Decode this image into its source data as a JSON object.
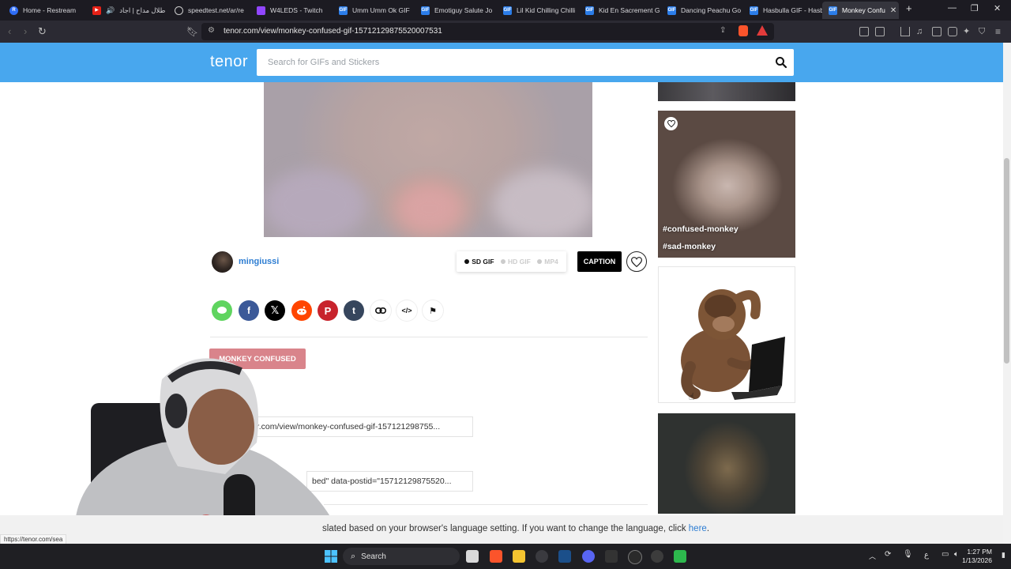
{
  "browser": {
    "tabs": [
      {
        "title": "Home - Restream",
        "icon": "restream-icon"
      },
      {
        "title": "طلال مداح | اجاد",
        "icon": "youtube-icon"
      },
      {
        "title": "speedtest.net/ar/re",
        "icon": "github-icon"
      },
      {
        "title": "W4LEDS - Twitch",
        "icon": "twitch-icon"
      },
      {
        "title": "Umm Umm Ok GIF",
        "icon": "gif-icon"
      },
      {
        "title": "Emotiguy Salute Jo",
        "icon": "gif-icon"
      },
      {
        "title": "Lil Kid Chilling Chilli",
        "icon": "gif-icon"
      },
      {
        "title": "Kid En Sacrement G",
        "icon": "gif-icon"
      },
      {
        "title": "Dancing Peachu Go",
        "icon": "gif-icon"
      },
      {
        "title": "Hasbulla GIF - Hasb",
        "icon": "gif-icon"
      },
      {
        "title": "Monkey Confu",
        "icon": "gif-icon",
        "active": true
      }
    ],
    "url": "tenor.com/view/monkey-confused-gif-15712129875520007531",
    "status_url": "https://tenor.com/sea"
  },
  "tenor": {
    "logo": "tenor",
    "search_placeholder": "Search for GIFs and Stickers"
  },
  "gif": {
    "author": "mingiussi",
    "formats": [
      "SD GIF",
      "HD GIF",
      "MP4"
    ],
    "selected_format": "SD GIF",
    "caption_label": "CAPTION",
    "share_icons": [
      "message-icon",
      "facebook-icon",
      "x-icon",
      "reddit-icon",
      "pinterest-icon",
      "tumblr-icon",
      "link-icon",
      "embed-icon",
      "flag-icon"
    ],
    "tag": "MONKEY CONFUSED",
    "share_url_partial": "or.com/view/monkey-confused-gif-157121298755...",
    "embed_partial": "bed\" data-postid=\"15712129875520..."
  },
  "related": {
    "tags": [
      "#confused-monkey",
      "#sad-monkey"
    ]
  },
  "language_banner": {
    "text": "slated based on your browser's language setting. If you want to change the language, click ",
    "link": "here",
    "suffix": "."
  },
  "taskbar": {
    "search_label": "Search",
    "time": "1:27 PM",
    "date": "1/13/2026",
    "lang": "ع"
  }
}
